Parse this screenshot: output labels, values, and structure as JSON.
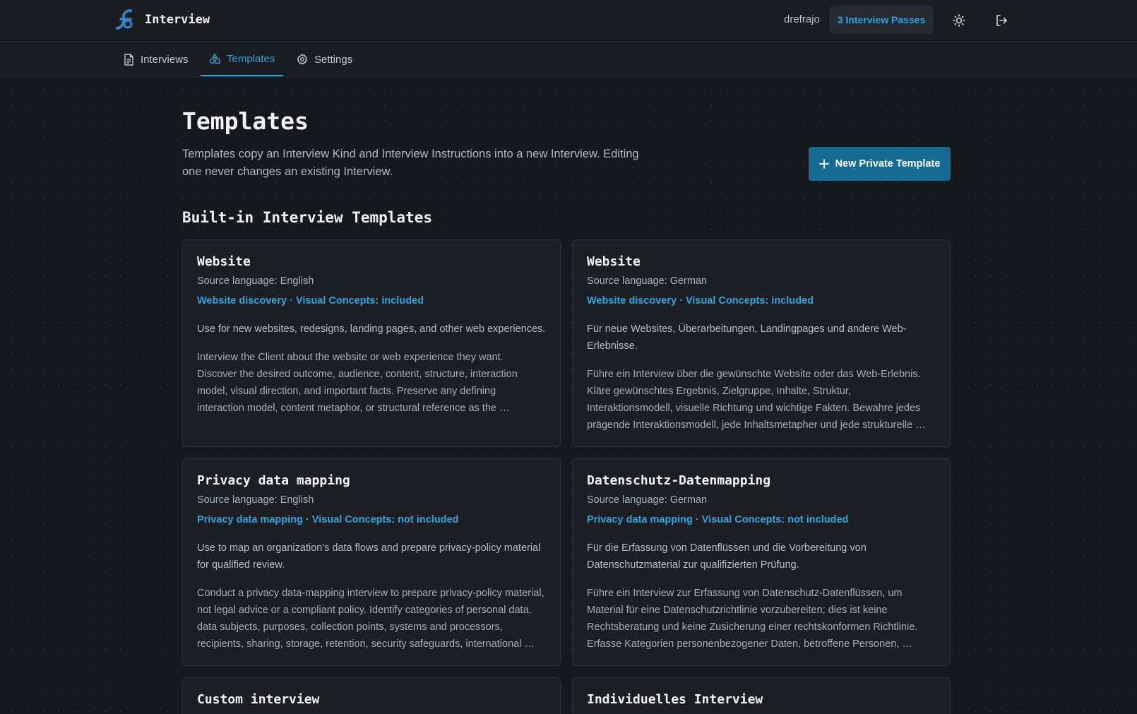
{
  "app": {
    "title": "Interview",
    "username": "drefrajo",
    "passes_label": "3 Interview Passes"
  },
  "nav": {
    "tabs": [
      {
        "label": "Interviews",
        "icon": "document-icon",
        "active": false
      },
      {
        "label": "Templates",
        "icon": "templates-icon",
        "active": true
      },
      {
        "label": "Settings",
        "icon": "gear-icon",
        "active": false
      }
    ]
  },
  "page": {
    "title": "Templates",
    "description": "Templates copy an Interview Kind and Interview Instructions into a new Interview. Editing one never changes an existing Interview.",
    "new_button_label": "New Private Template",
    "section_title": "Built-in Interview Templates"
  },
  "templates": [
    {
      "title": "Website",
      "language": "Source language: English",
      "meta": "Website discovery · Visual Concepts: included",
      "summary": "Use for new websites, redesigns, landing pages, and other web experiences.",
      "body": "Interview the Client about the website or web experience they want. Discover the desired outcome, audience, content, structure, interaction model, visual direction, and important facts. Preserve any defining interaction model, content metaphor, or structural reference as the …"
    },
    {
      "title": "Website",
      "language": "Source language: German",
      "meta": "Website discovery · Visual Concepts: included",
      "summary": "Für neue Websites, Überarbeitungen, Landingpages und andere Web-Erlebnisse.",
      "body": "Führe ein Interview über die gewünschte Website oder das Web-Erlebnis. Kläre gewünschtes Ergebnis, Zielgruppe, Inhalte, Struktur, Interaktionsmodell, visuelle Richtung und wichtige Fakten. Bewahre jedes prägende Interaktionsmodell, jede Inhaltsmetapher und jede strukturelle …"
    },
    {
      "title": "Privacy data mapping",
      "language": "Source language: English",
      "meta": "Privacy data mapping · Visual Concepts: not included",
      "summary": "Use to map an organization's data flows and prepare privacy-policy material for qualified review.",
      "body": "Conduct a privacy data-mapping interview to prepare privacy-policy material, not legal advice or a compliant policy. Identify categories of personal data, data subjects, purposes, collection points, systems and processors, recipients, sharing, storage, retention, security safeguards, international …"
    },
    {
      "title": "Datenschutz-Datenmapping",
      "language": "Source language: German",
      "meta": "Privacy data mapping · Visual Concepts: not included",
      "summary": "Für die Erfassung von Datenflüssen und die Vorbereitung von Datenschutzmaterial zur qualifizierten Prüfung.",
      "body": "Führe ein Interview zur Erfassung von Datenschutz-Datenflüssen, um Material für eine Datenschutzrichtlinie vorzubereiten; dies ist keine Rechtsberatung und keine Zusicherung einer rechtskonformen Richtlinie. Erfasse Kategorien personenbezogener Daten, betroffene Personen, …"
    },
    {
      "title": "Custom interview",
      "language": "",
      "meta": "",
      "summary": "",
      "body": ""
    },
    {
      "title": "Individuelles Interview",
      "language": "",
      "meta": "",
      "summary": "",
      "body": ""
    }
  ],
  "colors": {
    "accent": "#2aa6e0",
    "primary_button": "#176a92",
    "background": "#16181d",
    "card": "#1c1e23"
  }
}
